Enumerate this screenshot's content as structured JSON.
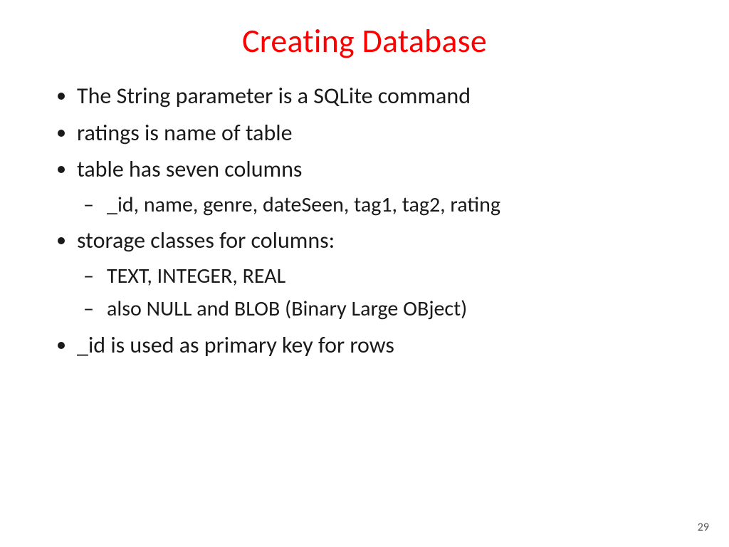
{
  "title": "Creating Database",
  "bullets": {
    "b1": "The String parameter is a SQLite command",
    "b2": "ratings is name of table",
    "b3": "table has seven columns",
    "b3_sub1": "_id, name, genre, dateSeen, tag1, tag2,  rating",
    "b4": "storage classes for columns:",
    "b4_sub1": "TEXT, INTEGER, REAL",
    "b4_sub2": "also NULL and BLOB (Binary Large OBject)",
    "b5": "_id is used as primary key for rows"
  },
  "page_number": "29"
}
